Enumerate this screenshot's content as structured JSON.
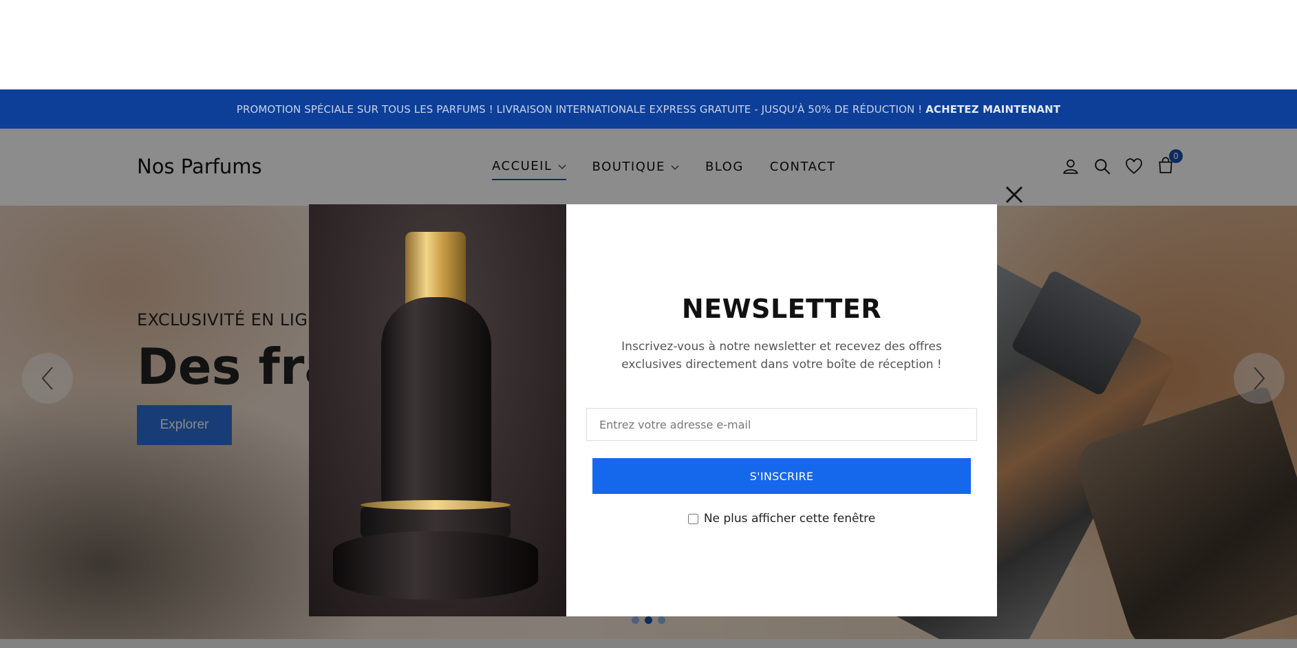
{
  "promo": {
    "text": "PROMOTION SPÉCIALE SUR TOUS LES PARFUMS ! LIVRAISON INTERNATIONALE EXPRESS GRATUITE - JUSQU'À 50% DE RÉDUCTION !",
    "cta": "ACHETEZ MAINTENANT"
  },
  "header": {
    "logo": "Nos Parfums",
    "nav": [
      {
        "label": "ACCUEIL"
      },
      {
        "label": "BOUTIQUE"
      },
      {
        "label": "BLOG"
      },
      {
        "label": "CONTACT"
      }
    ],
    "cart_count": "0",
    "icons": [
      "user-icon",
      "search-icon",
      "heart-icon",
      "cart-icon"
    ]
  },
  "hero": {
    "kicker": "EXCLUSIVITÉ EN LIGNE",
    "title": "Des frag",
    "button": "Explorer",
    "active_slide": 2
  },
  "modal": {
    "title": "NEWSLETTER",
    "description": "Inscrivez-vous à notre newsletter et recevez des offres exclusives directement dans votre boîte de réception !",
    "email_placeholder": "Entrez votre adresse e-mail",
    "submit_label": "S'INSCRIRE",
    "dont_show_label": "Ne plus afficher cette fenêtre"
  },
  "colors": {
    "promo_bar": "#0d3f98",
    "accent": "#1567ec",
    "hero_button": "#2c6dd6"
  }
}
